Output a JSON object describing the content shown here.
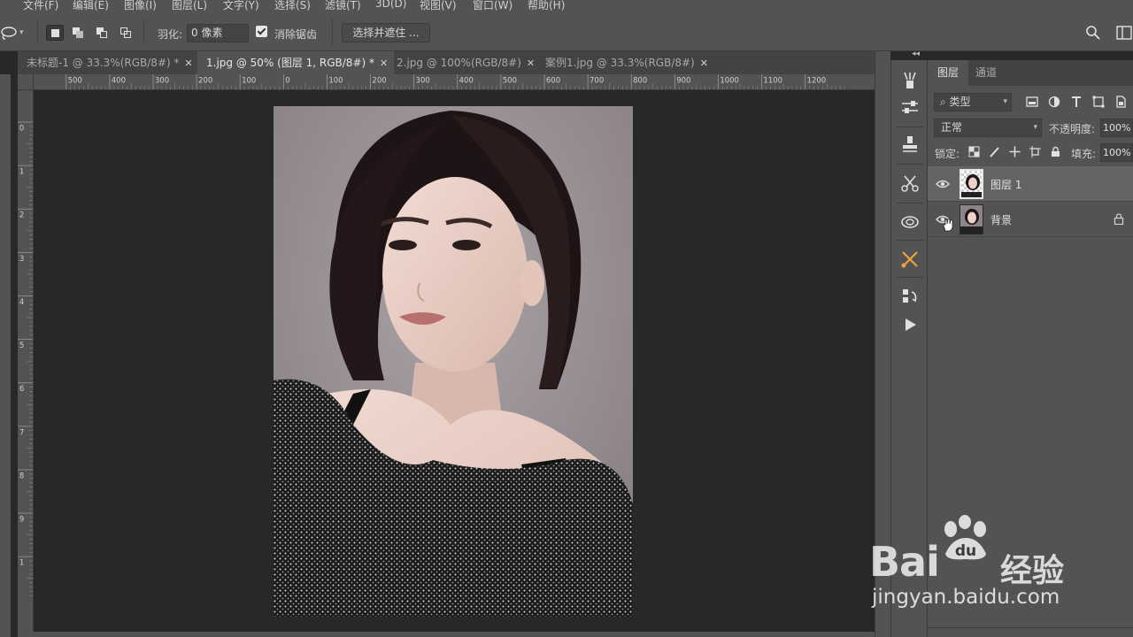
{
  "menu": [
    "文件(F)",
    "编辑(E)",
    "图像(I)",
    "图层(L)",
    "文字(Y)",
    "选择(S)",
    "滤镜(T)",
    "3D(D)",
    "视图(V)",
    "窗口(W)",
    "帮助(H)"
  ],
  "options": {
    "feather_label": "羽化:",
    "feather_value": "0 像素",
    "antialias_label": "消除锯齿",
    "antialias_checked": true,
    "select_mask_label": "选择并遮住 ..."
  },
  "doc_tabs": [
    {
      "label": "未标题-1 @ 33.3%(RGB/8#) *",
      "active": false
    },
    {
      "label": "1.jpg @ 50% (图层 1, RGB/8#) *",
      "active": true
    },
    {
      "label": "2.jpg @ 100%(RGB/8#)",
      "active": false
    },
    {
      "label": "案例1.jpg @ 33.3%(RGB/8#)",
      "active": false
    }
  ],
  "ruler_h_labels": [
    "500",
    "400",
    "300",
    "200",
    "100",
    "0",
    "100",
    "200",
    "300",
    "400",
    "500",
    "600",
    "700",
    "800",
    "900",
    "1000",
    "1100",
    "1200"
  ],
  "ruler_v_labels": [
    "0",
    "1",
    "2",
    "3",
    "4",
    "5",
    "6",
    "7",
    "8",
    "9",
    "1"
  ],
  "layers_panel": {
    "tabs": [
      "图层",
      "通道"
    ],
    "filter_label": "类型",
    "blend_mode": "正常",
    "opacity_label": "不透明度:",
    "opacity_value": "100%",
    "lock_label": "锁定:",
    "fill_label": "填充:",
    "fill_value": "100%",
    "layers": [
      {
        "name": "图层 1",
        "selected": true,
        "visible": true,
        "locked": false
      },
      {
        "name": "背景",
        "selected": false,
        "visible": true,
        "locked": true
      }
    ]
  },
  "watermark": {
    "brand": "Bai",
    "brand_du": "du",
    "cn": "经验",
    "url": "jingyan.baidu.com"
  },
  "colors": {
    "panel_bg": "#535353",
    "canvas_bg": "#282828",
    "tab_bg": "#434343",
    "active_tool_accent": "#e8a33a"
  }
}
